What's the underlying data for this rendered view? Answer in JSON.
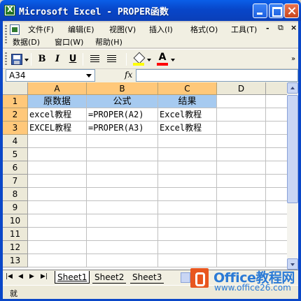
{
  "window": {
    "title": "Microsoft Excel - PROPER函数"
  },
  "menu": {
    "items": [
      "文件(F)",
      "编辑(E)",
      "视图(V)",
      "插入(I)",
      "格式(O)",
      "工具(T)",
      "数据(D)",
      "窗口(W)",
      "帮助(H)"
    ],
    "doc_min": "-",
    "doc_restore": "⧉",
    "doc_close": "×"
  },
  "toolbar": {
    "bold": "B",
    "italic": "I",
    "underline": "U",
    "font_color_letter": "A",
    "more": "»",
    "fill_color": "#ffff00",
    "font_color": "#ff0000"
  },
  "formula_bar": {
    "name_box": "A34",
    "fx": "fx",
    "formula": ""
  },
  "grid": {
    "columns": [
      "A",
      "B",
      "C",
      "D"
    ],
    "rows": [
      "1",
      "2",
      "3",
      "4",
      "5",
      "6",
      "7",
      "8",
      "9",
      "10",
      "11",
      "12",
      "13"
    ],
    "cells": {
      "A1": "原数据",
      "B1": "公式",
      "C1": "结果",
      "A2": "excel教程",
      "B2": "=PROPER(A2)",
      "C2": "Excel教程",
      "A3": "EXCEL教程",
      "B3": "=PROPER(A3)",
      "C3": "Excel教程"
    },
    "header_fill": "#a6caf0",
    "highlight_header": "#ffc87a"
  },
  "sheets": {
    "nav": [
      "|◀",
      "◀",
      "▶",
      "▶|"
    ],
    "tabs": [
      "Sheet1",
      "Sheet2",
      "Sheet3"
    ],
    "active": "Sheet1"
  },
  "status": {
    "text": "就"
  },
  "watermark": {
    "title": "Office教程网",
    "url": "www.office26.com"
  }
}
